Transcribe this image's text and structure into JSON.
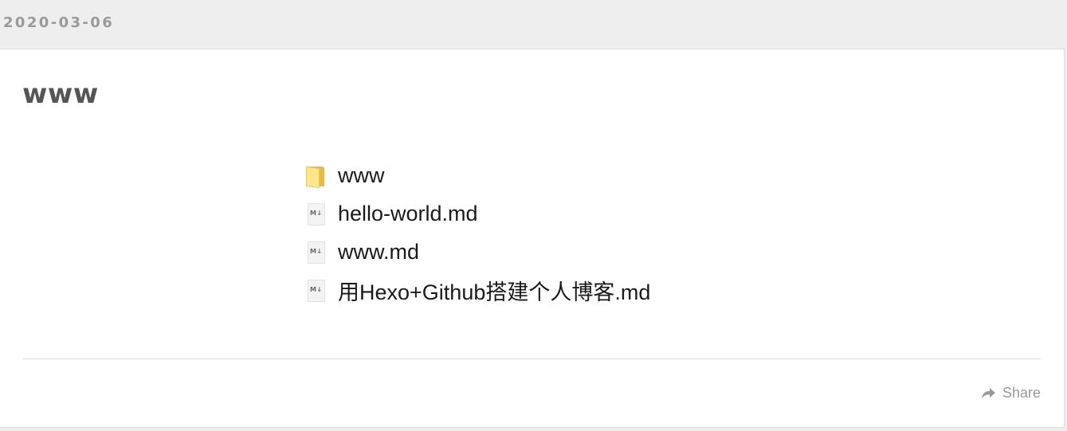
{
  "post": {
    "date": "2020-03-06",
    "title": "www"
  },
  "file_list": [
    {
      "name": "www",
      "icon": "folder-icon"
    },
    {
      "name": "hello-world.md",
      "icon": "markdown-file-icon"
    },
    {
      "name": "www.md",
      "icon": "markdown-file-icon"
    },
    {
      "name": "用Hexo+Github搭建个人博客.md",
      "icon": "markdown-file-icon"
    }
  ],
  "icon_text": {
    "markdown_mark": "M↓"
  },
  "footer": {
    "share_label": "Share",
    "share_icon": "share-arrow-icon"
  },
  "colors": {
    "page_background": "#eeeeee",
    "card_background": "#ffffff",
    "date_text": "#999999",
    "title_text": "#555555",
    "folder_yellow": "#fde68c"
  }
}
